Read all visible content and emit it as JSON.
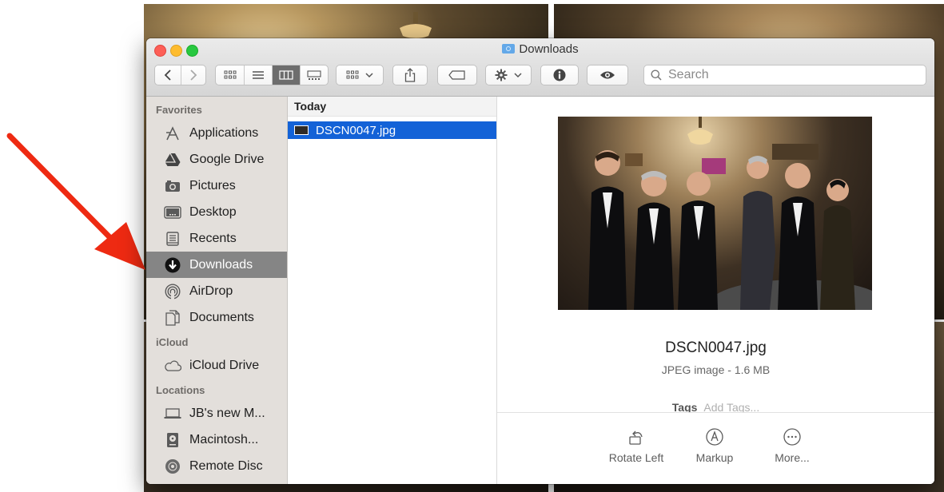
{
  "window": {
    "title": "Downloads",
    "search_placeholder": "Search"
  },
  "sidebar": {
    "sections": [
      {
        "header": "Favorites",
        "items": [
          {
            "label": "Applications",
            "icon": "applications-icon"
          },
          {
            "label": "Google Drive",
            "icon": "google-drive-icon"
          },
          {
            "label": "Pictures",
            "icon": "camera-icon"
          },
          {
            "label": "Desktop",
            "icon": "desktop-icon"
          },
          {
            "label": "Recents",
            "icon": "recents-icon"
          },
          {
            "label": "Downloads",
            "icon": "downloads-icon",
            "selected": true
          },
          {
            "label": "AirDrop",
            "icon": "airdrop-icon"
          },
          {
            "label": "Documents",
            "icon": "documents-icon"
          }
        ]
      },
      {
        "header": "iCloud",
        "items": [
          {
            "label": "iCloud Drive",
            "icon": "cloud-icon"
          }
        ]
      },
      {
        "header": "Locations",
        "items": [
          {
            "label": "JB's new M...",
            "icon": "laptop-icon"
          },
          {
            "label": "Macintosh...",
            "icon": "disk-icon"
          },
          {
            "label": "Remote Disc",
            "icon": "remote-disc-icon"
          }
        ]
      }
    ]
  },
  "column": {
    "header": "Today",
    "files": [
      {
        "name": "DSCN0047.jpg",
        "selected": true
      }
    ]
  },
  "preview": {
    "name": "DSCN0047.jpg",
    "meta": "JPEG image - 1.6 MB",
    "tags_label": "Tags",
    "tags_placeholder": "Add Tags...",
    "actions": [
      {
        "label": "Rotate Left",
        "icon": "rotate-left-icon"
      },
      {
        "label": "Markup",
        "icon": "markup-icon"
      },
      {
        "label": "More...",
        "icon": "more-icon"
      }
    ]
  },
  "colors": {
    "selection": "#1362d7",
    "sidebar_selected": "#858585",
    "arrow": "#ee2a12"
  }
}
